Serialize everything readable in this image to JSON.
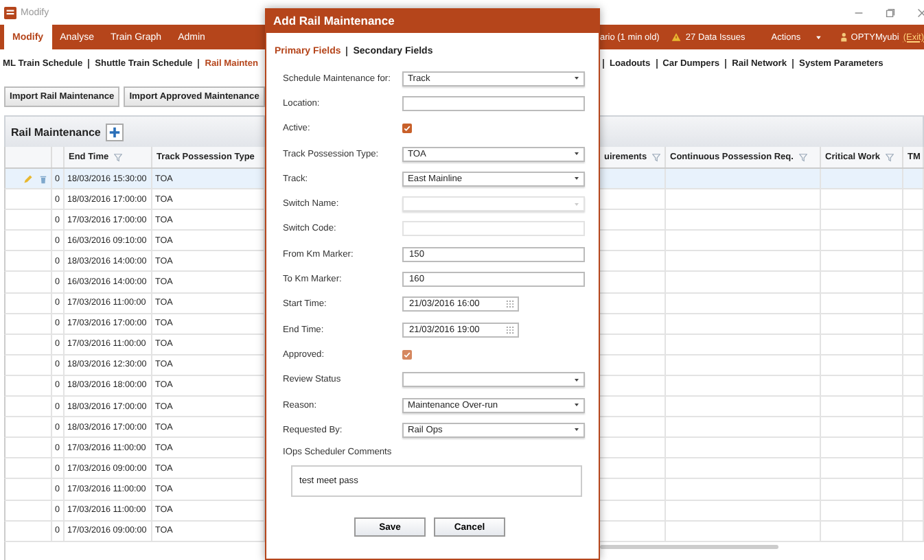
{
  "window": {
    "title": "Modify"
  },
  "menu": {
    "tabs": [
      {
        "label": "Modify",
        "selected": true
      },
      {
        "label": "Analyse",
        "selected": false
      },
      {
        "label": "Train Graph",
        "selected": false
      },
      {
        "label": "Admin",
        "selected": false
      }
    ],
    "status": "ario (1 min old)",
    "issues": "27 Data Issues",
    "actions": "Actions",
    "user": "OPTYMyubi",
    "exit": "(Exit)"
  },
  "nav": {
    "left": [
      {
        "label": "ML Train Schedule",
        "selected": false
      },
      {
        "label": "Shuttle Train Schedule",
        "selected": false
      },
      {
        "label": "Rail Mainten",
        "selected": true
      }
    ],
    "right": [
      {
        "label": "Loadouts",
        "selected": false
      },
      {
        "label": "Car Dumpers",
        "selected": false
      },
      {
        "label": "Rail Network",
        "selected": false
      },
      {
        "label": "System Parameters",
        "selected": false
      }
    ]
  },
  "toolbar": {
    "buttons": [
      "Import Rail Maintenance",
      "Import Approved Maintenance"
    ]
  },
  "panel": {
    "title": "Rail Maintenance"
  },
  "table": {
    "left_columns": [
      "End Time",
      "Track Possession Type"
    ],
    "right_columns": [
      "uirements",
      "Continuous Possession Req.",
      "Critical Work",
      "TM"
    ],
    "rows": [
      {
        "selected": true,
        "count": "0",
        "end_time": "18/03/2016 15:30:00",
        "type": "TOA"
      },
      {
        "selected": false,
        "count": "0",
        "end_time": "18/03/2016 17:00:00",
        "type": "TOA"
      },
      {
        "selected": false,
        "count": "0",
        "end_time": "17/03/2016 17:00:00",
        "type": "TOA"
      },
      {
        "selected": false,
        "count": "0",
        "end_time": "16/03/2016 09:10:00",
        "type": "TOA"
      },
      {
        "selected": false,
        "count": "0",
        "end_time": "18/03/2016 14:00:00",
        "type": "TOA"
      },
      {
        "selected": false,
        "count": "0",
        "end_time": "16/03/2016 14:00:00",
        "type": "TOA"
      },
      {
        "selected": false,
        "count": "0",
        "end_time": "17/03/2016 11:00:00",
        "type": "TOA"
      },
      {
        "selected": false,
        "count": "0",
        "end_time": "17/03/2016 17:00:00",
        "type": "TOA"
      },
      {
        "selected": false,
        "count": "0",
        "end_time": "17/03/2016 11:00:00",
        "type": "TOA"
      },
      {
        "selected": false,
        "count": "0",
        "end_time": "18/03/2016 12:30:00",
        "type": "TOA"
      },
      {
        "selected": false,
        "count": "0",
        "end_time": "18/03/2016 18:00:00",
        "type": "TOA"
      },
      {
        "selected": false,
        "count": "0",
        "end_time": "18/03/2016 17:00:00",
        "type": "TOA"
      },
      {
        "selected": false,
        "count": "0",
        "end_time": "18/03/2016 17:00:00",
        "type": "TOA"
      },
      {
        "selected": false,
        "count": "0",
        "end_time": "17/03/2016 11:00:00",
        "type": "TOA"
      },
      {
        "selected": false,
        "count": "0",
        "end_time": "17/03/2016 09:00:00",
        "type": "TOA"
      },
      {
        "selected": false,
        "count": "0",
        "end_time": "17/03/2016 11:00:00",
        "type": "TOA"
      },
      {
        "selected": false,
        "count": "0",
        "end_time": "17/03/2016 11:00:00",
        "type": "TOA"
      },
      {
        "selected": false,
        "count": "0",
        "end_time": "17/03/2016 09:00:00",
        "type": "TOA"
      }
    ]
  },
  "dialog": {
    "title": "Add Rail Maintenance",
    "tabs": [
      {
        "label": "Primary Fields",
        "selected": true
      },
      {
        "label": "Secondary Fields",
        "selected": false
      }
    ],
    "fields": [
      {
        "label": "Schedule Maintenance for:",
        "kind": "select",
        "value": "Track",
        "disabled": false
      },
      {
        "label": "Location:",
        "kind": "text",
        "disabled": false
      },
      {
        "label": "Active:",
        "kind": "checkbox",
        "checked": true,
        "disabled": false
      },
      {
        "label": "Track Possession Type:",
        "kind": "select",
        "value": "TOA",
        "disabled": false
      },
      {
        "label": "Track:",
        "kind": "select",
        "value": "East Mainline",
        "disabled": false
      },
      {
        "label": "Switch Name:",
        "kind": "select",
        "disabled": true
      },
      {
        "label": "Switch Code:",
        "kind": "text",
        "disabled": true
      },
      {
        "label": "From Km Marker:",
        "kind": "text",
        "value": "150",
        "disabled": false
      },
      {
        "label": "To Km Marker:",
        "kind": "text",
        "value": "160",
        "disabled": false
      },
      {
        "label": "Start Time:",
        "kind": "datetime",
        "value": "21/03/2016 16:00",
        "disabled": false
      },
      {
        "label": "End Time:",
        "kind": "datetime",
        "value": "21/03/2016 19:00",
        "disabled": false
      },
      {
        "label": "Approved:",
        "kind": "checkbox",
        "checked": true,
        "disabled": true
      },
      {
        "label": "Review Status",
        "kind": "select",
        "disabled": false
      },
      {
        "label": "Reason:",
        "kind": "select",
        "value": "Maintenance Over-run",
        "disabled": false
      },
      {
        "label": "Requested By:",
        "kind": "select",
        "value": "Rail Ops",
        "disabled": false
      }
    ],
    "comments": {
      "label": "IOps Scheduler Comments",
      "value": "test meet pass"
    },
    "buttons": [
      "Save",
      "Cancel"
    ]
  }
}
